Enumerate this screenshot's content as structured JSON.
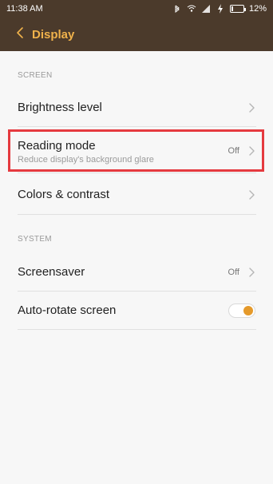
{
  "status_bar": {
    "time": "11:38 AM",
    "battery_percent": "12%",
    "icons": [
      "bluetooth-icon",
      "wifi-icon",
      "signal-icon",
      "charging-icon",
      "battery-icon"
    ]
  },
  "app_bar": {
    "back_icon": "chevron-left-icon",
    "title": "Display"
  },
  "sections": {
    "screen": {
      "header": "SCREEN",
      "items": [
        {
          "title": "Brightness level"
        },
        {
          "title": "Reading mode",
          "subtitle": "Reduce display's background glare",
          "value": "Off"
        },
        {
          "title": "Colors & contrast"
        }
      ]
    },
    "system": {
      "header": "SYSTEM",
      "items": [
        {
          "title": "Screensaver",
          "value": "Off"
        },
        {
          "title": "Auto-rotate screen",
          "toggle": true
        }
      ]
    }
  },
  "colors": {
    "app_bar": "#4b3a2b",
    "title_accent": "#f0b24b",
    "highlight_border": "#e53a3f",
    "toggle_knob": "#e59a2b"
  }
}
